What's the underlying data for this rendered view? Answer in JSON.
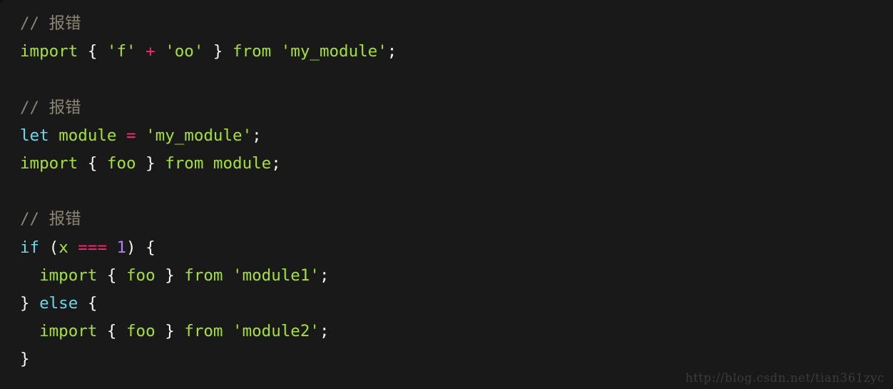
{
  "editor": {
    "background_color": "#191919",
    "language": "javascript",
    "watermark": "http://blog.csdn.net/tian361zyc",
    "theme_colors": {
      "comment": "#8a8574",
      "keyword": "#66d9ef",
      "string": "#a6e22e",
      "identifier": "#a6e22e",
      "operator": "#f92672",
      "number": "#ae81ff",
      "punctuation": "#f6f6ef",
      "plain": "#f6f6ef"
    }
  },
  "code": {
    "lines": [
      {
        "id": "line-1",
        "tokens": [
          {
            "text": "// 报错",
            "type": "comment"
          }
        ]
      },
      {
        "id": "line-2",
        "tokens": [
          {
            "text": "import ",
            "type": "ident"
          },
          {
            "text": "{ ",
            "type": "punct"
          },
          {
            "text": "'f'",
            "type": "string"
          },
          {
            "text": " ",
            "type": "plain"
          },
          {
            "text": "+",
            "type": "operator"
          },
          {
            "text": " ",
            "type": "plain"
          },
          {
            "text": "'oo'",
            "type": "string"
          },
          {
            "text": " }",
            "type": "punct"
          },
          {
            "text": " from ",
            "type": "ident"
          },
          {
            "text": "'my_module'",
            "type": "string"
          },
          {
            "text": ";",
            "type": "punct"
          }
        ]
      },
      {
        "id": "line-3",
        "tokens": [
          {
            "text": "",
            "type": "plain"
          }
        ]
      },
      {
        "id": "line-4",
        "tokens": [
          {
            "text": "// 报错",
            "type": "comment"
          }
        ]
      },
      {
        "id": "line-5",
        "tokens": [
          {
            "text": "let",
            "type": "keyword"
          },
          {
            "text": " ",
            "type": "plain"
          },
          {
            "text": "module",
            "type": "ident"
          },
          {
            "text": " ",
            "type": "plain"
          },
          {
            "text": "=",
            "type": "operator"
          },
          {
            "text": " ",
            "type": "plain"
          },
          {
            "text": "'my_module'",
            "type": "string"
          },
          {
            "text": ";",
            "type": "punct"
          }
        ]
      },
      {
        "id": "line-6",
        "tokens": [
          {
            "text": "import ",
            "type": "ident"
          },
          {
            "text": "{ ",
            "type": "punct"
          },
          {
            "text": "foo",
            "type": "ident"
          },
          {
            "text": " }",
            "type": "punct"
          },
          {
            "text": " from module",
            "type": "ident"
          },
          {
            "text": ";",
            "type": "punct"
          }
        ]
      },
      {
        "id": "line-7",
        "tokens": [
          {
            "text": "",
            "type": "plain"
          }
        ]
      },
      {
        "id": "line-8",
        "tokens": [
          {
            "text": "// 报错",
            "type": "comment"
          }
        ]
      },
      {
        "id": "line-9",
        "tokens": [
          {
            "text": "if",
            "type": "keyword"
          },
          {
            "text": " (",
            "type": "punct"
          },
          {
            "text": "x",
            "type": "ident"
          },
          {
            "text": " ",
            "type": "plain"
          },
          {
            "text": "===",
            "type": "operator"
          },
          {
            "text": " ",
            "type": "plain"
          },
          {
            "text": "1",
            "type": "number"
          },
          {
            "text": ") {",
            "type": "punct"
          }
        ]
      },
      {
        "id": "line-10",
        "tokens": [
          {
            "text": "  ",
            "type": "plain"
          },
          {
            "text": "import ",
            "type": "ident"
          },
          {
            "text": "{ ",
            "type": "punct"
          },
          {
            "text": "foo",
            "type": "ident"
          },
          {
            "text": " }",
            "type": "punct"
          },
          {
            "text": " from ",
            "type": "ident"
          },
          {
            "text": "'module1'",
            "type": "string"
          },
          {
            "text": ";",
            "type": "punct"
          }
        ]
      },
      {
        "id": "line-11",
        "tokens": [
          {
            "text": "} ",
            "type": "punct"
          },
          {
            "text": "else",
            "type": "keyword"
          },
          {
            "text": " {",
            "type": "punct"
          }
        ]
      },
      {
        "id": "line-12",
        "tokens": [
          {
            "text": "  ",
            "type": "plain"
          },
          {
            "text": "import ",
            "type": "ident"
          },
          {
            "text": "{ ",
            "type": "punct"
          },
          {
            "text": "foo",
            "type": "ident"
          },
          {
            "text": " }",
            "type": "punct"
          },
          {
            "text": " from ",
            "type": "ident"
          },
          {
            "text": "'module2'",
            "type": "string"
          },
          {
            "text": ";",
            "type": "punct"
          }
        ]
      },
      {
        "id": "line-13",
        "tokens": [
          {
            "text": "}",
            "type": "punct"
          }
        ]
      }
    ]
  }
}
